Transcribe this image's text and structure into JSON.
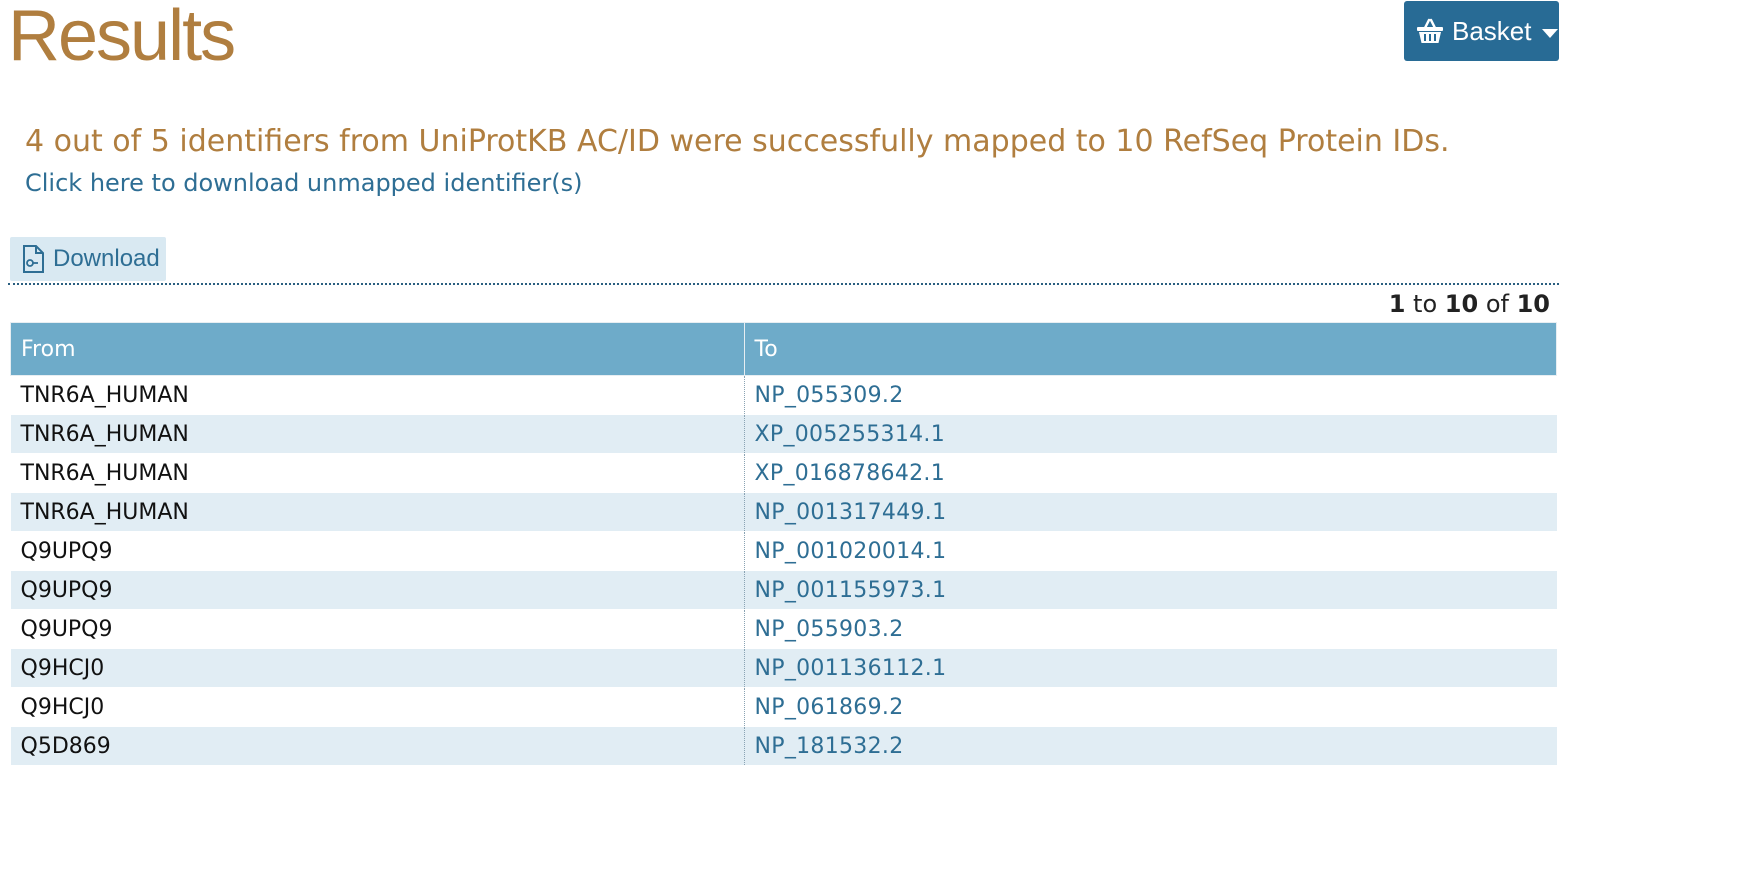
{
  "page": {
    "title": "Results"
  },
  "basket": {
    "label": "Basket",
    "icon": "basket-icon"
  },
  "summary": {
    "text": "4 out of 5 identifiers from UniProtKB AC/ID were successfully mapped to 10 RefSeq Protein IDs.",
    "unmapped_link": "Click here to download unmapped identifier(s)"
  },
  "toolbar": {
    "download_label": "Download",
    "download_icon": "download-file-icon"
  },
  "pager": {
    "start": "1",
    "to_word": "to",
    "end": "10",
    "of_word": "of",
    "total": "10"
  },
  "table": {
    "columns": [
      "From",
      "To"
    ],
    "rows": [
      {
        "from": "TNR6A_HUMAN",
        "to": "NP_055309.2"
      },
      {
        "from": "TNR6A_HUMAN",
        "to": "XP_005255314.1"
      },
      {
        "from": "TNR6A_HUMAN",
        "to": "XP_016878642.1"
      },
      {
        "from": "TNR6A_HUMAN",
        "to": "NP_001317449.1"
      },
      {
        "from": "Q9UPQ9",
        "to": "NP_001020014.1"
      },
      {
        "from": "Q9UPQ9",
        "to": "NP_001155973.1"
      },
      {
        "from": "Q9UPQ9",
        "to": "NP_055903.2"
      },
      {
        "from": "Q9HCJ0",
        "to": "NP_001136112.1"
      },
      {
        "from": "Q9HCJ0",
        "to": "NP_061869.2"
      },
      {
        "from": "Q5D869",
        "to": "NP_181532.2"
      }
    ]
  },
  "colors": {
    "title": "#b07e3f",
    "link": "#2e6e94",
    "header": "#6eabc9",
    "basket_bg": "#286b95",
    "row_alt": "#e1edf4"
  }
}
